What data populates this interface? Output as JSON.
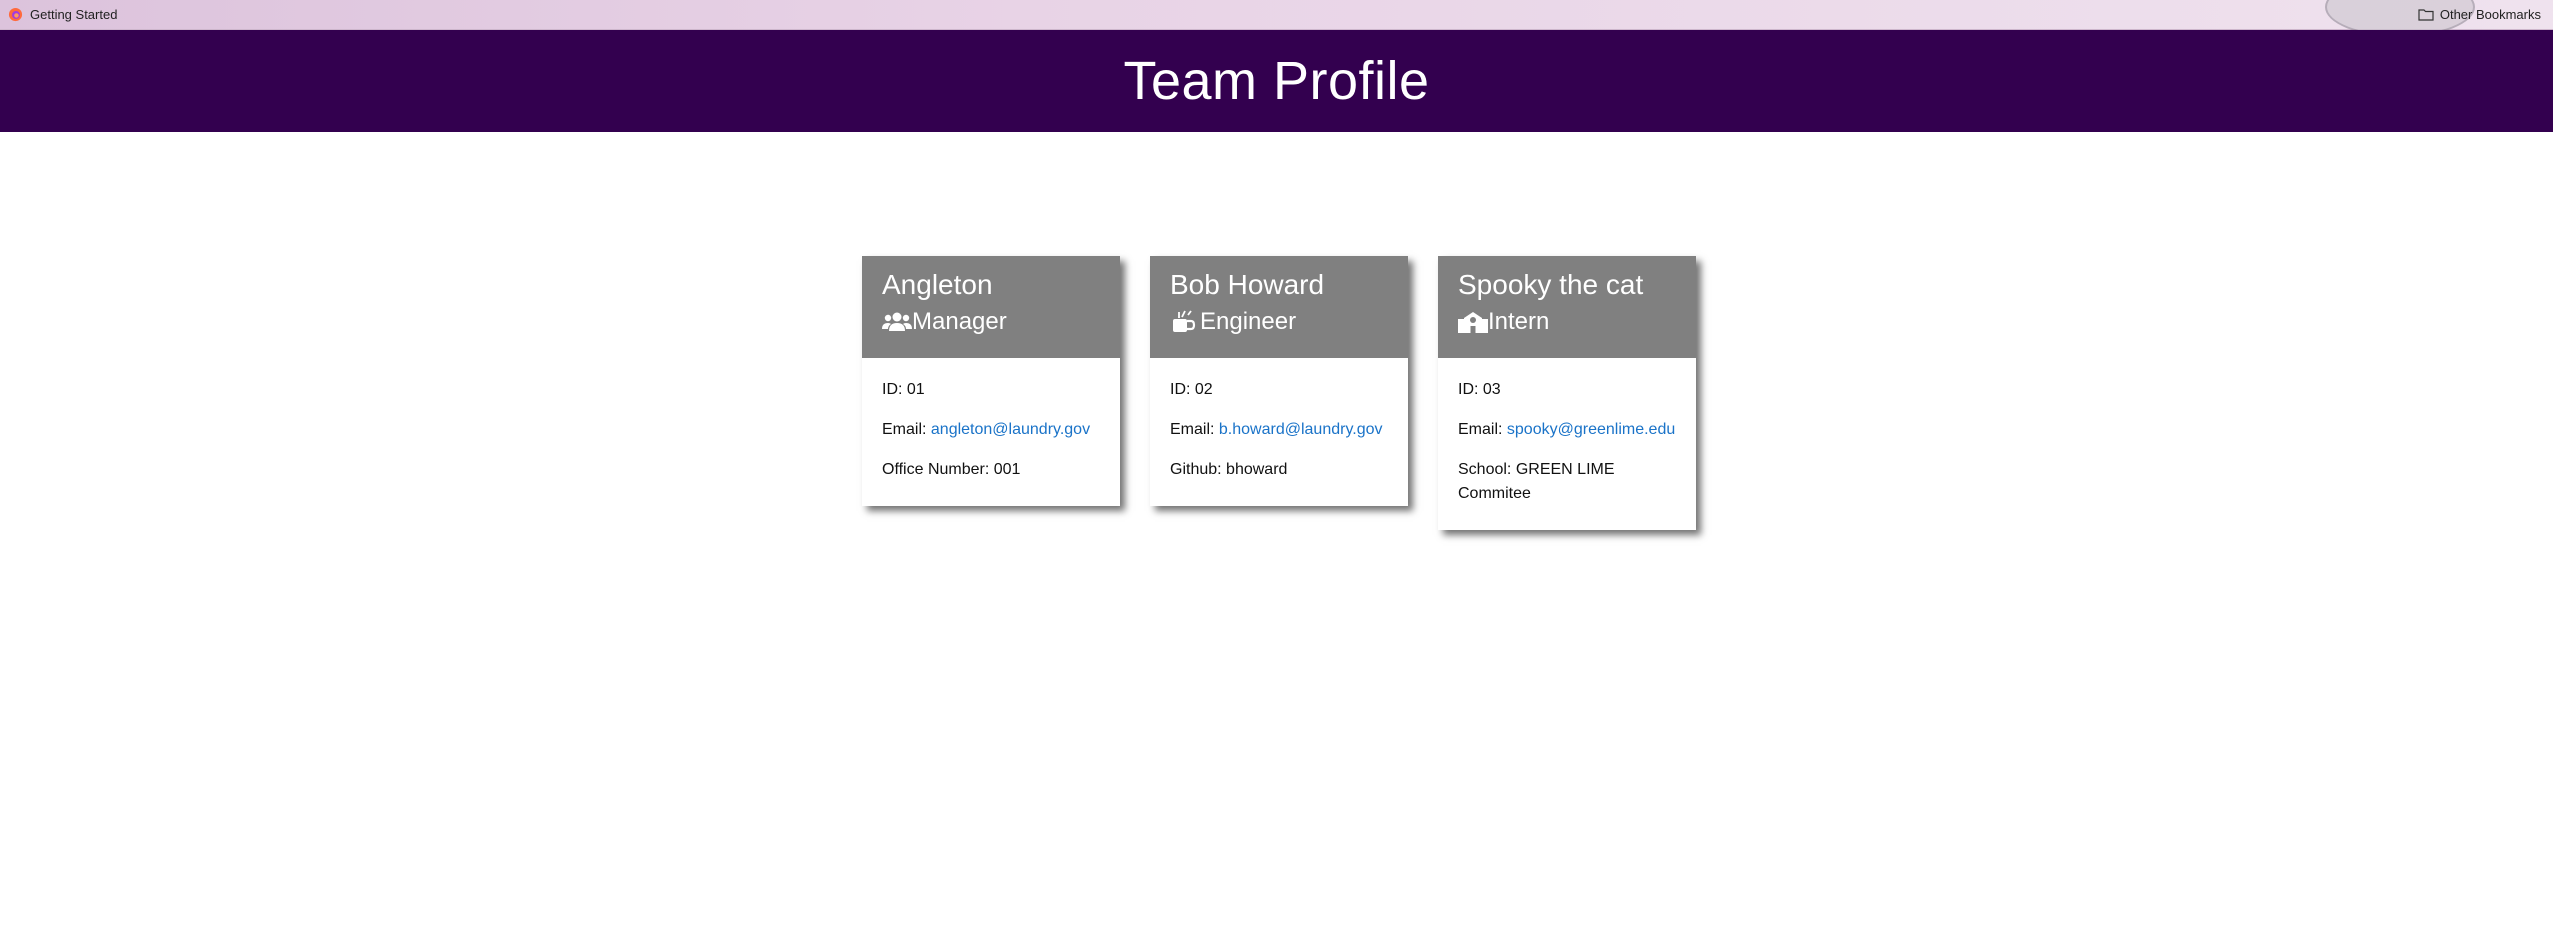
{
  "bookmarks": {
    "left_label": "Getting Started",
    "right_label": "Other Bookmarks"
  },
  "header": {
    "title": "Team Profile"
  },
  "colors": {
    "header_bg": "#33004f",
    "card_header_bg": "#808080",
    "link": "#1a73c8"
  },
  "cards": [
    {
      "name": "Angleton",
      "role": "Manager",
      "icon": "users-icon",
      "id_label": "ID:",
      "id_value": "01",
      "email_label": "Email:",
      "email": "angleton@laundry.gov",
      "extra_label": "Office Number:",
      "extra_value": "001"
    },
    {
      "name": "Bob Howard",
      "role": "Engineer",
      "icon": "engineer-mug-icon",
      "id_label": "ID:",
      "id_value": "02",
      "email_label": "Email:",
      "email": "b.howard@laundry.gov",
      "extra_label": "Github:",
      "extra_value": "bhoward"
    },
    {
      "name": "Spooky the cat",
      "role": "Intern",
      "icon": "school-icon",
      "id_label": "ID:",
      "id_value": "03",
      "email_label": "Email:",
      "email": "spooky@greenlime.edu",
      "extra_label": "School:",
      "extra_value": "GREEN LIME Commitee"
    }
  ]
}
